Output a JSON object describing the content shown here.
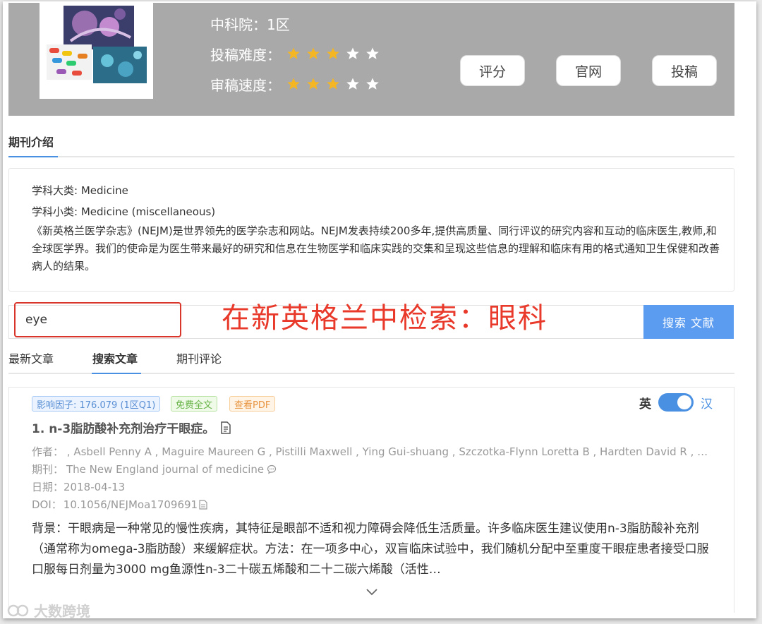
{
  "header": {
    "cas_label": "中科院：",
    "cas_value": "1区",
    "difficulty_label": "投稿难度：",
    "difficulty_rating": 3,
    "review_speed_label": "审稿速度：",
    "review_speed_rating": 3,
    "max_rating": 5,
    "buttons": {
      "rate": "评分",
      "official": "官网",
      "submit": "投稿"
    }
  },
  "intro": {
    "tab": "期刊介绍",
    "category_label": "学科大类: ",
    "category_value": "Medicine",
    "subcategory_label": "学科小类: ",
    "subcategory_value": "Medicine (miscellaneous)",
    "description": "《新英格兰医学杂志》(NEJM)是世界领先的医学杂志和网站。NEJM发表持续200多年,提供高质量、同行评议的研究内容和互动的临床医生,教师,和全球医学界。我们的使命是为医生带来最好的研究和信息在生物医学和临床实践的交集和呈现这些信息的理解和临床有用的格式通知卫生保健和改善病人的结果。"
  },
  "search": {
    "value": "eye",
    "button": "搜索 文献",
    "annotation": "在新英格兰中检索：眼科"
  },
  "article_tabs": {
    "latest": "最新文章",
    "search": "搜索文章",
    "comments": "期刊评论"
  },
  "article": {
    "tag_if": "影响因子: 176.079 (1区Q1)",
    "tag_free": "免费全文",
    "tag_pdf": "查看PDF",
    "title": "1. n-3脂肪酸补充剂治疗干眼症。",
    "authors_label": "作者：",
    "authors": " , Asbell Penny A , Maguire Maureen G , Pistilli Maxwell , Ying Gui-shuang , Szczotka-Flynn Loretta B , Hardten David R , Lin Meng C , Shtein Roni M",
    "journal_label": "期刊：",
    "journal": "The New England journal of medicine",
    "date_label": "日期：",
    "date": "2018-04-13",
    "doi_label": "DOI：",
    "doi": "10.1056/NEJMoa1709691",
    "abstract": "背景：干眼病是一种常见的慢性疾病，其特征是眼部不适和视力障碍会降低生活质量。许多临床医生建议使用n-3脂肪酸补充剂（通常称为omega-3脂肪酸）来缓解症状。方法：在一项多中心，双盲临床试验中，我们随机分配中至重度干眼症患者接受口服口服每日剂量为3000 mg鱼源性n-3二十碳五烯酸和二十二碳六烯酸（活性…",
    "toggle_en": "英",
    "toggle_zh": "汉"
  },
  "watermark": "大数跨境",
  "colors": {
    "accent": "#4a90e2",
    "star": "#f5b623",
    "header_bg": "#a9a9a9",
    "annotation": "#e8392a"
  }
}
